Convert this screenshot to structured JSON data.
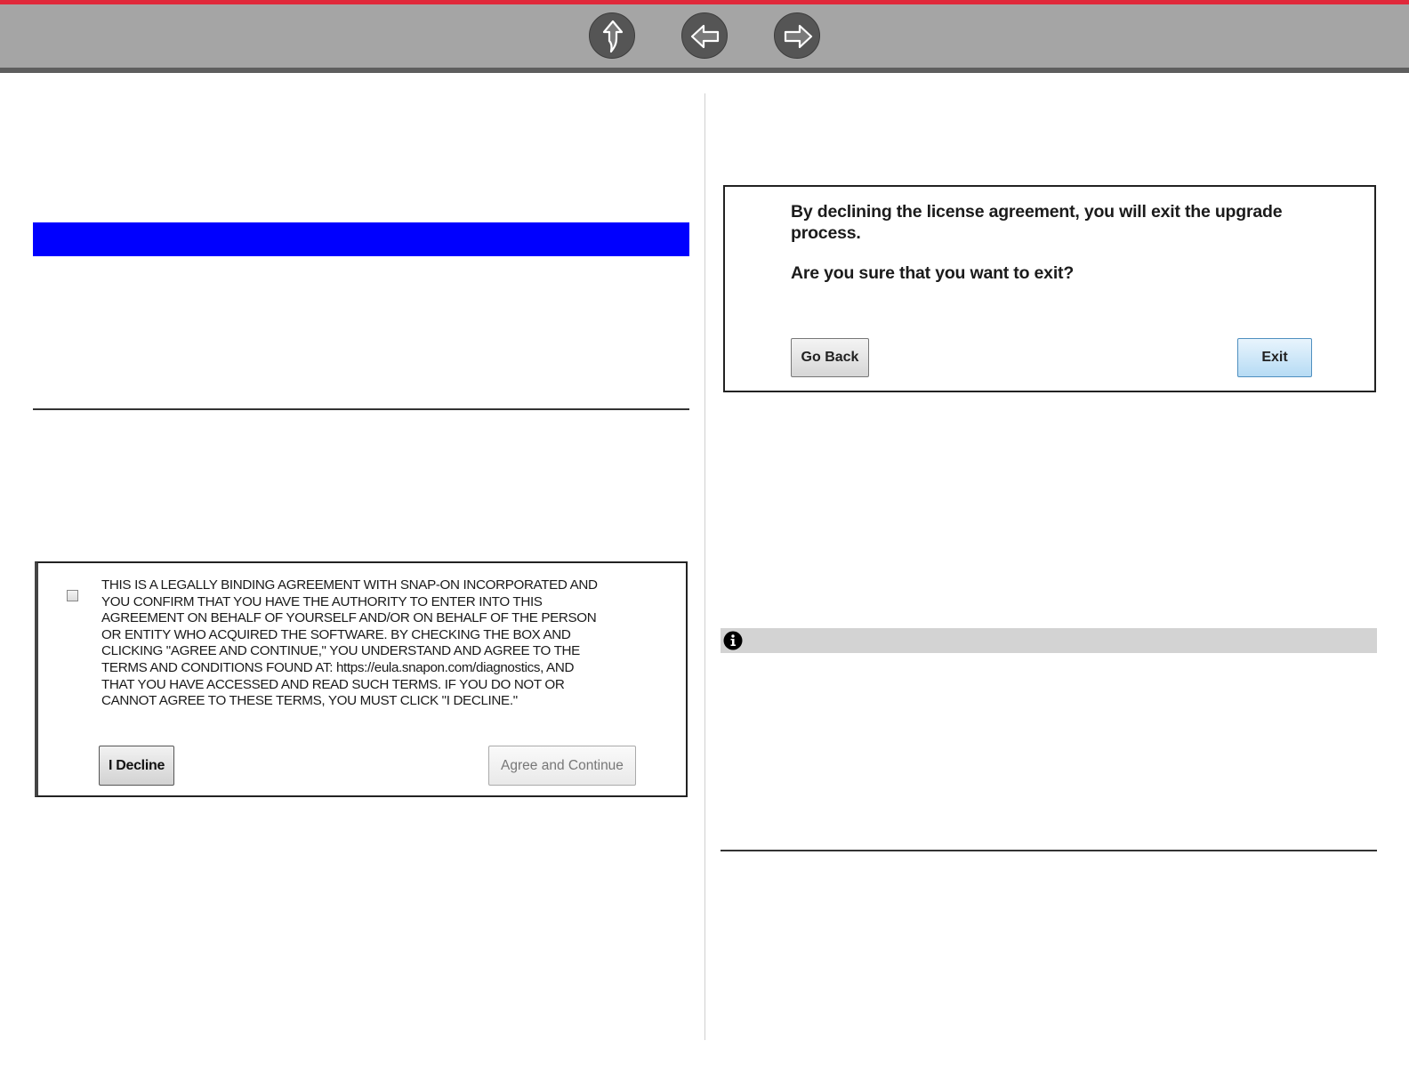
{
  "navigation": {
    "up_icon": "up-arrow-icon",
    "back_icon": "left-arrow-icon",
    "forward_icon": "right-arrow-icon",
    "accent_color": "#e0283a"
  },
  "license_panel": {
    "checkbox_checked": false,
    "text": "THIS IS A LEGALLY BINDING AGREEMENT WITH SNAP-ON INCORPORATED AND\nYOU CONFIRM THAT YOU HAVE THE AUTHORITY TO ENTER INTO THIS\nAGREEMENT ON BEHALF OF YOURSELF AND/OR ON BEHALF OF THE PERSON\nOR ENTITY WHO ACQUIRED THE SOFTWARE. BY CHECKING THE BOX AND\nCLICKING \"AGREE AND CONTINUE,\" YOU UNDERSTAND AND AGREE TO THE\nTERMS AND CONDITIONS FOUND AT: https://eula.snapon.com/diagnostics, AND\nTHAT YOU HAVE ACCESSED AND READ SUCH TERMS. IF YOU DO NOT OR\nCANNOT AGREE TO THESE TERMS, YOU MUST CLICK \"I DECLINE.\"",
    "decline_label": "I Decline",
    "agree_label": "Agree and Continue"
  },
  "exit_dialog": {
    "message": "By declining the license agreement, you will exit the upgrade process.",
    "question": "Are you sure that you want to exit?",
    "go_back_label": "Go Back",
    "exit_label": "Exit"
  },
  "note": {
    "icon": "info-icon"
  },
  "colors": {
    "section_band": "#0000ff",
    "note_bar": "#d3d3d3"
  }
}
